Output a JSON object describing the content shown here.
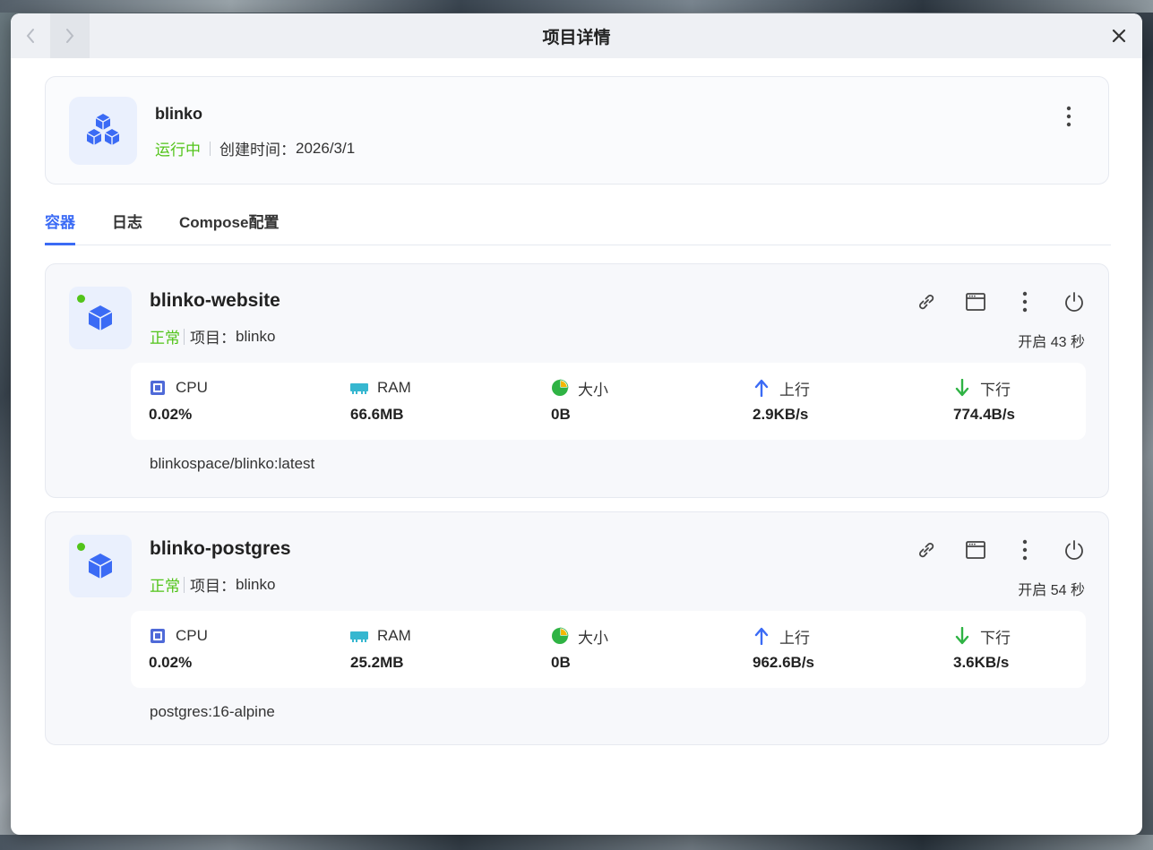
{
  "window": {
    "title": "项目详情"
  },
  "project": {
    "name": "blinko",
    "status": "运行中",
    "created_label": "创建时间：",
    "created_value": "2026/3/1"
  },
  "tabs": [
    {
      "label": "容器",
      "active": true
    },
    {
      "label": "日志",
      "active": false
    },
    {
      "label": "Compose配置",
      "active": false
    }
  ],
  "containers": [
    {
      "name": "blinko-website",
      "status": "正常",
      "project_label": "项目：",
      "project_value": "blinko",
      "uptime": "开启 43 秒",
      "stats": {
        "cpu_label": "CPU",
        "cpu_value": "0.02%",
        "ram_label": "RAM",
        "ram_value": "66.6MB",
        "size_label": "大小",
        "size_value": "0B",
        "up_label": "上行",
        "up_value": "2.9KB/s",
        "down_label": "下行",
        "down_value": "774.4B/s"
      },
      "image": "blinkospace/blinko:latest"
    },
    {
      "name": "blinko-postgres",
      "status": "正常",
      "project_label": "项目：",
      "project_value": "blinko",
      "uptime": "开启 54 秒",
      "stats": {
        "cpu_label": "CPU",
        "cpu_value": "0.02%",
        "ram_label": "RAM",
        "ram_value": "25.2MB",
        "size_label": "大小",
        "size_value": "0B",
        "up_label": "上行",
        "up_value": "962.6B/s",
        "down_label": "下行",
        "down_value": "3.6KB/s"
      },
      "image": "postgres:16-alpine"
    }
  ],
  "colors": {
    "accent": "#3b6bf5",
    "status_ok": "#52c41a",
    "icon_blue": "#3b6bf5"
  }
}
